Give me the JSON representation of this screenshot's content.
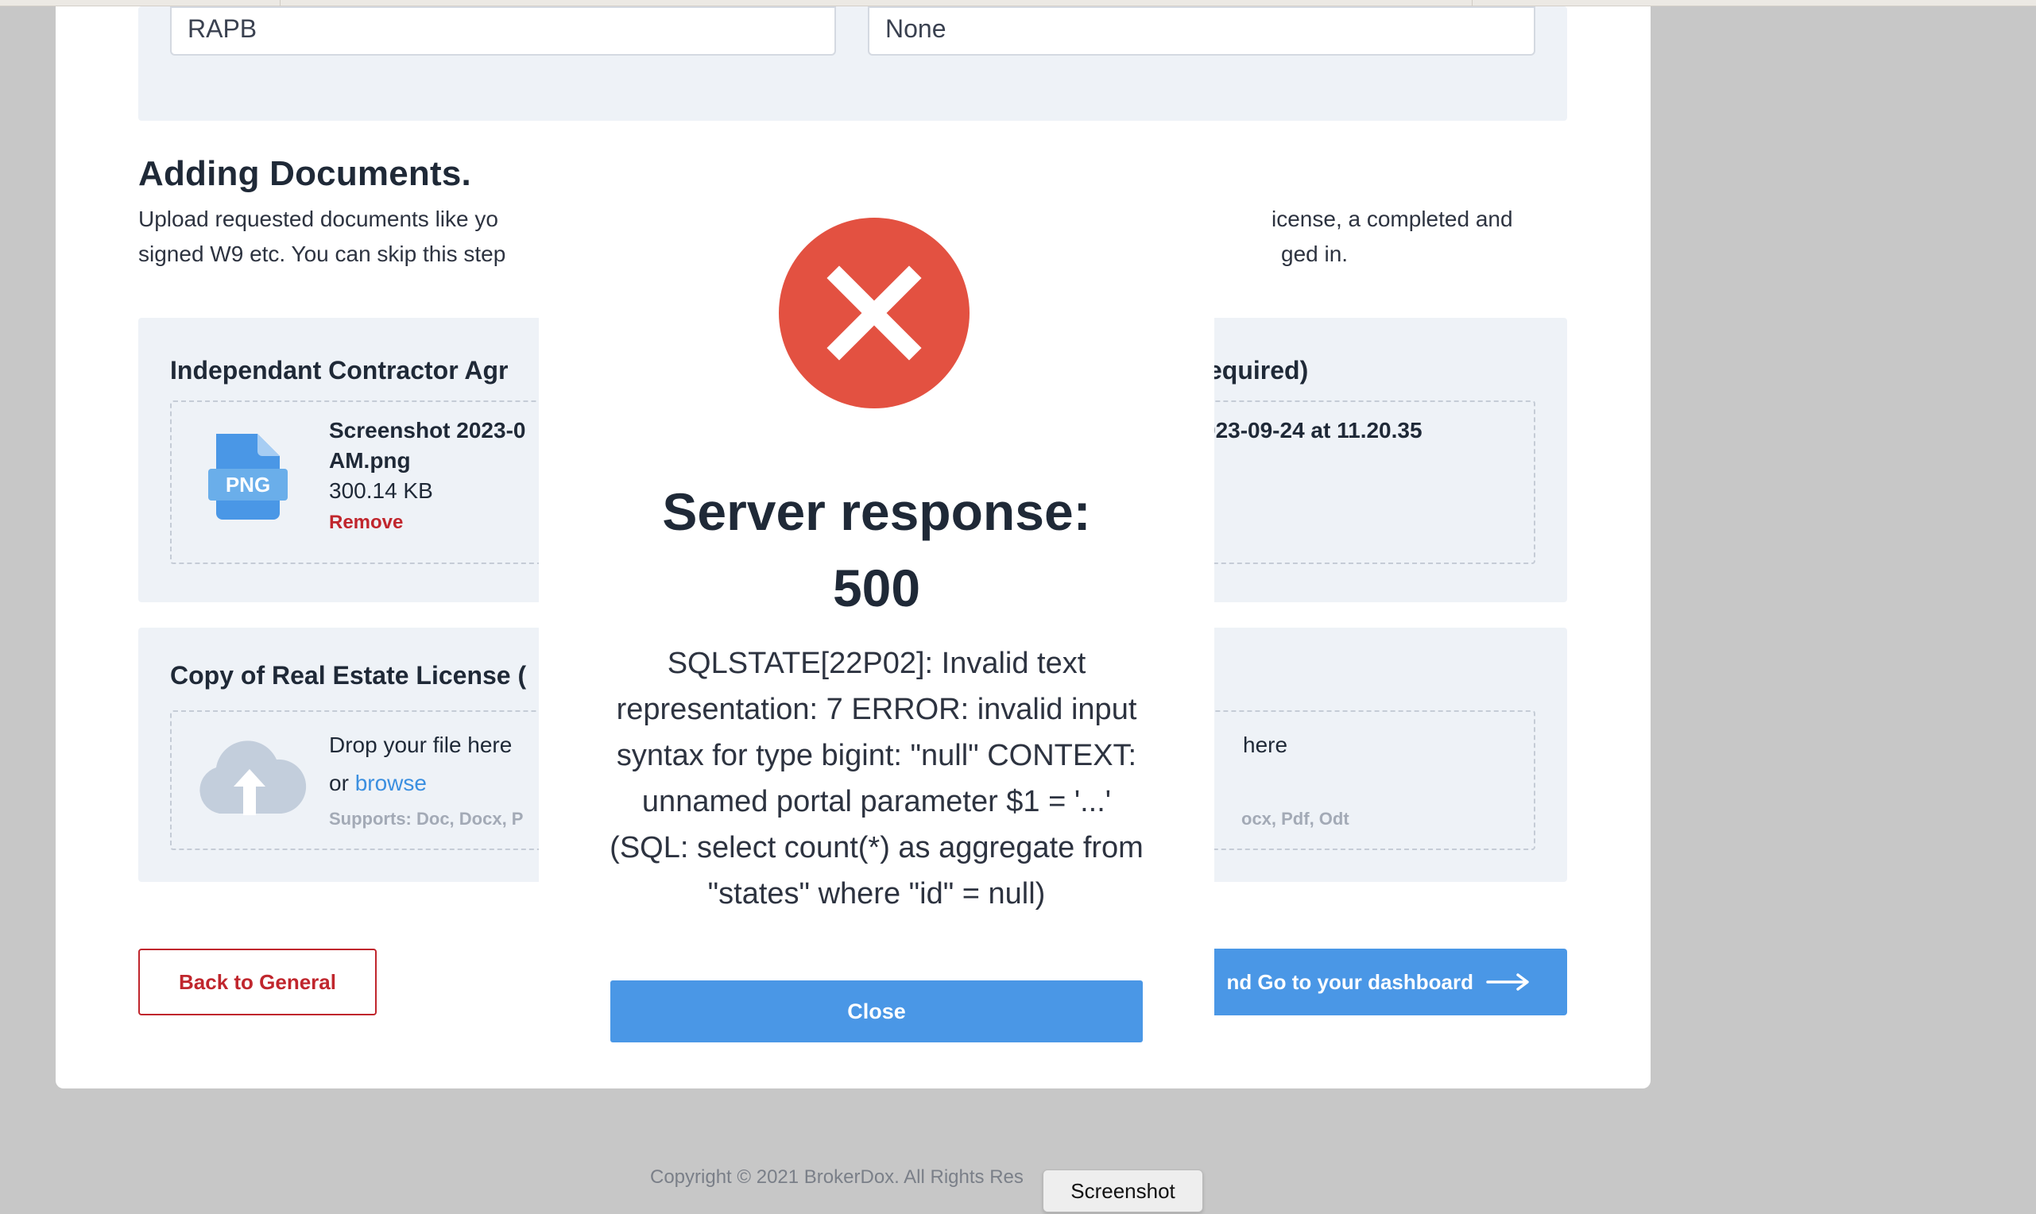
{
  "form": {
    "field_left_value": "RAPB",
    "field_right_value": "None"
  },
  "documents": {
    "title": "Adding Documents.",
    "desc_line1_left": "Upload requested documents like yo",
    "desc_line1_right": "icense, a completed and",
    "desc_line2_left": "signed W9 etc. You can skip this step",
    "desc_line2_right": "ged in."
  },
  "contract_panel": {
    "title_left": "Independant Contractor Agr",
    "title_right": "equired)",
    "file_name_line1": "Screenshot 2023-0",
    "file_name_line2": "AM.png",
    "file_size": "300.14 KB",
    "remove_label": "Remove",
    "file_type_label": "PNG",
    "right_file_name": "023-09-24 at 11.20.35"
  },
  "license_panel": {
    "title_left": "Copy of Real Estate License (",
    "drop_text": "Drop your file here",
    "or_text": "or",
    "browse_label": "browse",
    "supports_left": "Supports: Doc, Docx, P",
    "right_drop_text": "here",
    "supports_right": "ocx, Pdf, Odt"
  },
  "buttons": {
    "back_label": "Back to General",
    "next_label": "nd Go to your dashboard"
  },
  "footer": {
    "copyright": "Copyright © 2021 BrokerDox. All Rights Res"
  },
  "tooltip": {
    "label": "Screenshot"
  },
  "modal": {
    "title_line1": "Server response:",
    "title_line2": "500",
    "message": "SQLSTATE[22P02]: Invalid text representation: 7 ERROR: invalid input syntax for type bigint: \"null\" CONTEXT: unnamed portal parameter $1 = '...' (SQL: select count(*) as aggregate from \"states\" where \"id\" = null)",
    "close_label": "Close"
  },
  "colors": {
    "accent_blue": "#4a97e6",
    "danger_red": "#c0262d",
    "error_icon": "#e35141"
  },
  "icons": {
    "error": "x-circle-icon",
    "file": "png-file-icon",
    "upload": "cloud-upload-icon",
    "arrow": "arrow-right-icon"
  }
}
